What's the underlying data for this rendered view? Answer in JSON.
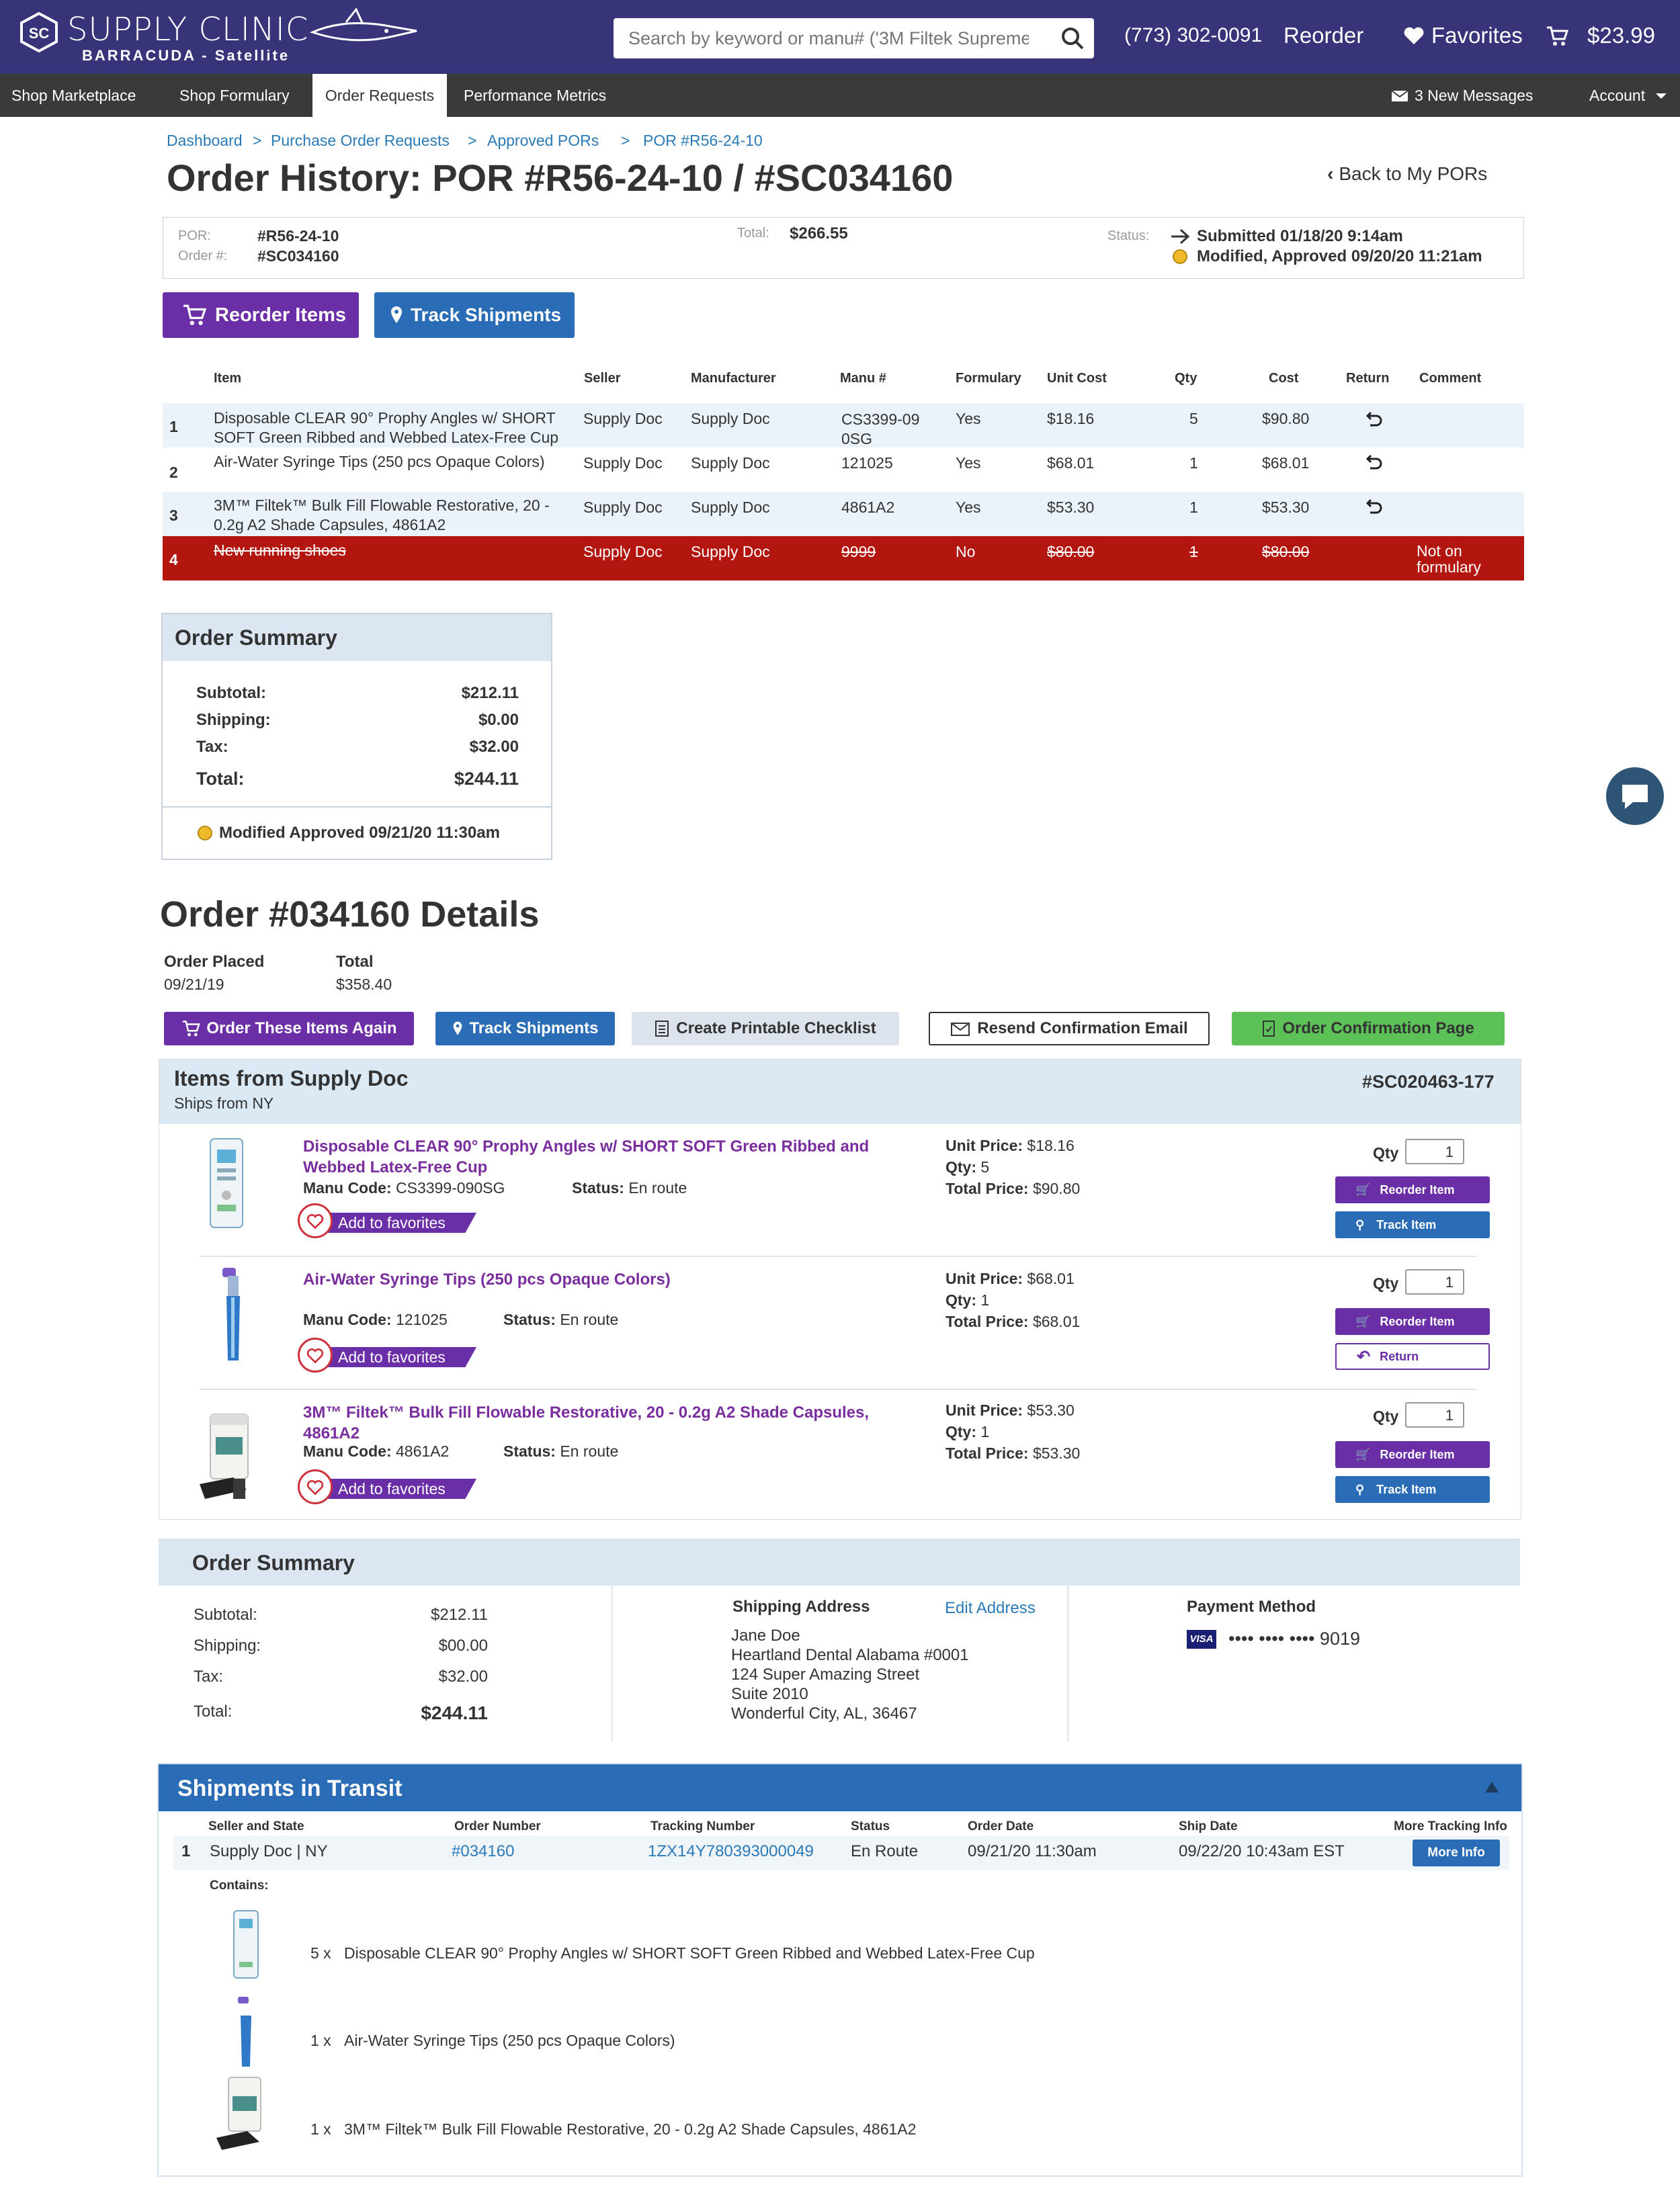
{
  "brand": {
    "name": "SUPPLY CLINIC",
    "sub": "BARRACUDA - Satellite",
    "mark": "SC"
  },
  "search": {
    "placeholder": "Search by keyword or manu# ('3M Filtek Supreme')"
  },
  "top": {
    "phone": "(773) 302-0091",
    "reorder": "Reorder",
    "favorites": "Favorites",
    "cart": "$23.99"
  },
  "nav": {
    "items": [
      "Shop Marketplace",
      "Shop Formulary",
      "Order Requests",
      "Performance Metrics"
    ],
    "messages": "3 New Messages",
    "account": "Account"
  },
  "breadcrumb": [
    "Dashboard",
    "Purchase Order Requests",
    "Approved PORs",
    "POR #R56-24-10"
  ],
  "title": "Order History: POR #R56-24-10 / #SC034160",
  "back": "Back to My PORs",
  "por": {
    "por_label": "POR:",
    "por": "#R56-24-10",
    "order_label": "Order #:",
    "order": "#SC034160",
    "total_label": "Total:",
    "total": "$266.55",
    "status_label": "Status:",
    "status1": "Submitted 01/18/20  9:14am",
    "status2": "Modified, Approved 09/20/20  11:21am"
  },
  "actions": {
    "reorder": "Reorder Items",
    "track": "Track Shipments"
  },
  "table": {
    "headers": [
      "Item",
      "Seller",
      "Manufacturer",
      "Manu #",
      "Formulary",
      "Unit Cost",
      "Qty",
      "Cost",
      "Return",
      "Comment"
    ],
    "rows": [
      {
        "n": "1",
        "item": "Disposable CLEAR 90° Prophy Angles w/ SHORT SOFT Green Ribbed and Webbed Latex-Free Cup",
        "seller": "Supply Doc",
        "mfr": "Supply Doc",
        "manu": "CS3399-09 0SG",
        "form": "Yes",
        "unit": "$18.16",
        "qty": "5",
        "cost": "$90.80",
        "comment": ""
      },
      {
        "n": "2",
        "item": "Air-Water Syringe Tips (250 pcs Opaque Colors)",
        "seller": "Supply Doc",
        "mfr": "Supply Doc",
        "manu": "121025",
        "form": "Yes",
        "unit": "$68.01",
        "qty": "1",
        "cost": "$68.01",
        "comment": ""
      },
      {
        "n": "3",
        "item": "3M™ Filtek™ Bulk Fill Flowable Restorative, 20 - 0.2g A2 Shade Capsules, 4861A2",
        "seller": "Supply Doc",
        "mfr": "Supply Doc",
        "manu": "4861A2",
        "form": "Yes",
        "unit": "$53.30",
        "qty": "1",
        "cost": "$53.30",
        "comment": ""
      },
      {
        "n": "4",
        "item": "New running shoes",
        "seller": "Supply Doc",
        "mfr": "Supply Doc",
        "manu": "9999",
        "form": "No",
        "unit": "$80.00",
        "qty": "1",
        "cost": "$80.00",
        "comment": "Not on formulary"
      }
    ]
  },
  "summary1": {
    "title": "Order Summary",
    "subtotal_label": "Subtotal:",
    "subtotal": "$212.11",
    "shipping_label": "Shipping:",
    "shipping": "$0.00",
    "tax_label": "Tax:",
    "tax": "$32.00",
    "total_label": "Total:",
    "total": "$244.11",
    "status": "Modified Approved 09/21/20  11:30am"
  },
  "details": {
    "title": "Order #034160 Details",
    "placed_label": "Order Placed",
    "placed": "09/21/19",
    "total_label": "Total",
    "total": "$358.40",
    "buttons": [
      "Order These Items Again",
      "Track Shipments",
      "Create Printable Checklist",
      "Resend Confirmation Email",
      "Order Confirmation Page"
    ],
    "supplier": "Items from Supply Doc",
    "ships_from": "Ships from NY",
    "ref": "#SC020463-177",
    "items": [
      {
        "title": "Disposable CLEAR 90° Prophy Angles w/ SHORT SOFT Green Ribbed and Webbed Latex-Free Cup",
        "manu_label": "Manu Code:",
        "manu": "CS3399-090SG",
        "status_label": "Status:",
        "status": "En route",
        "unit_label": "Unit Price:",
        "unit": "$18.16",
        "qty_label": "Qty:",
        "qty": "5",
        "total_label": "Total Price:",
        "total": "$90.80",
        "qty_input": "1",
        "btn1": "Reorder Item",
        "btn2": "Track Item"
      },
      {
        "title": "Air-Water Syringe Tips (250 pcs Opaque Colors)",
        "manu_label": "Manu Code:",
        "manu": "121025",
        "status_label": "Status:",
        "status": "En route",
        "unit_label": "Unit Price:",
        "unit": "$68.01",
        "qty_label": "Qty:",
        "qty": "1",
        "total_label": "Total Price:",
        "total": "$68.01",
        "qty_input": "1",
        "btn1": "Reorder Item",
        "btn2": "Return"
      },
      {
        "title": "3M™ Filtek™ Bulk Fill Flowable Restorative, 20 - 0.2g A2 Shade Capsules, 4861A2",
        "manu_label": "Manu Code:",
        "manu": "4861A2",
        "status_label": "Status:",
        "status": "En route",
        "unit_label": "Unit Price:",
        "unit": "$53.30",
        "qty_label": "Qty:",
        "qty": "1",
        "total_label": "Total Price:",
        "total": "$53.30",
        "qty_input": "1",
        "btn1": "Reorder Item",
        "btn2": "Track Item"
      }
    ],
    "fav": "Add to favorites",
    "qty_label": "Qty"
  },
  "summary2": {
    "title": "Order Summary",
    "subtotal_label": "Subtotal:",
    "subtotal": "$212.11",
    "shipping_label": "Shipping:",
    "shipping": "$00.00",
    "tax_label": "Tax:",
    "tax": "$32.00",
    "total_label": "Total:",
    "total": "$244.11",
    "ship_label": "Shipping Address",
    "edit": "Edit Address",
    "addr": [
      "Jane Doe",
      "Heartland Dental Alabama #0001",
      "124 Super Amazing Street",
      "Suite 2010",
      "Wonderful City, AL, 36467"
    ],
    "pay_label": "Payment Method",
    "card_brand": "VISA",
    "card": "•••• •••• •••• 9019"
  },
  "shipments": {
    "title": "Shipments in Transit",
    "headers": [
      "Seller and State",
      "Order Number",
      "Tracking Number",
      "Status",
      "Order Date",
      "Ship Date",
      "More Tracking Info"
    ],
    "row": {
      "n": "1",
      "seller": "Supply Doc | NY",
      "order": "#034160",
      "tracking": "1ZX14Y780393000049",
      "status": "En Route",
      "order_date": "09/21/20  11:30am",
      "ship_date": "09/22/20  10:43am EST",
      "more": "More Info"
    },
    "contains_label": "Contains:",
    "contents": [
      {
        "qty": "5 x",
        "name": "Disposable CLEAR 90° Prophy Angles w/ SHORT SOFT Green Ribbed and Webbed Latex-Free Cup"
      },
      {
        "qty": "1 x",
        "name": "Air-Water Syringe Tips (250 pcs Opaque Colors)"
      },
      {
        "qty": "1 x",
        "name": "3M™ Filtek™ Bulk Fill Flowable Restorative, 20 - 0.2g A2 Shade Capsules, 4861A2"
      }
    ]
  },
  "colors": {
    "brand": "#37347a",
    "nav": "#3a3a3a",
    "purple": "#6a2ea6",
    "blue": "#2a6cb5",
    "green": "#5cc157",
    "red": "#b3150f",
    "light_blue": "#dbe9f5"
  }
}
